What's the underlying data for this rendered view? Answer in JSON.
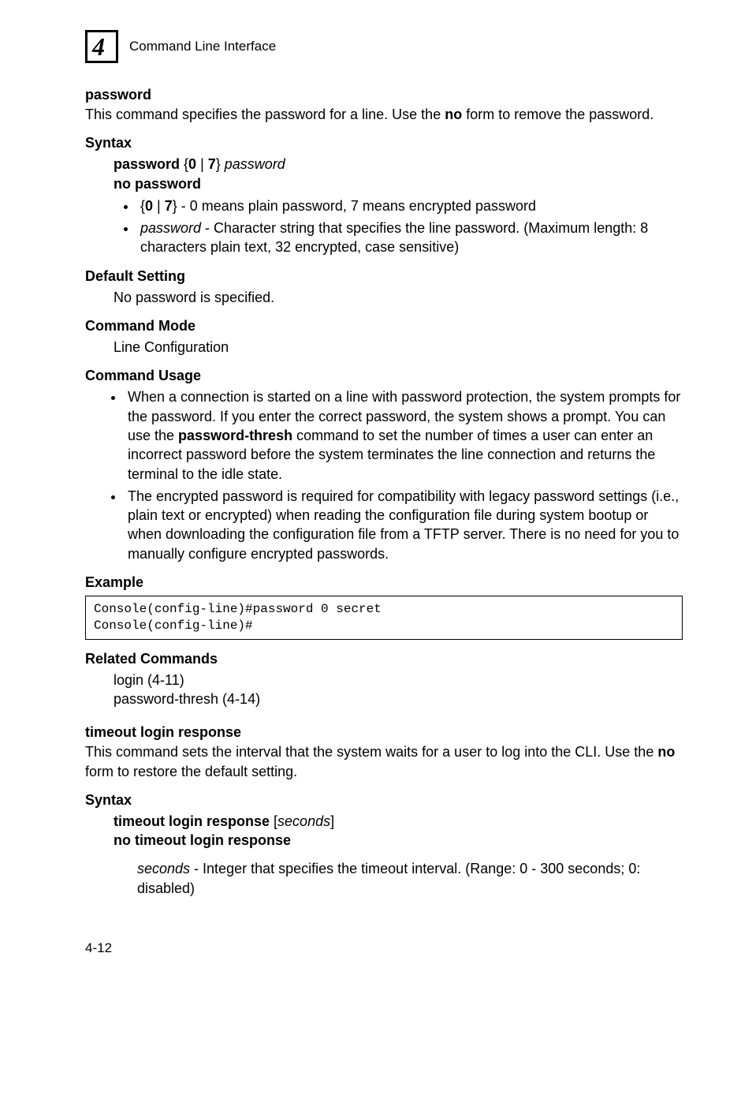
{
  "header": {
    "chapter_number": "4",
    "chapter_title": "Command Line Interface"
  },
  "password_cmd": {
    "name": "password",
    "desc_pre": "This command specifies the password for a line. Use the ",
    "desc_kw": "no",
    "desc_post": " form to remove the password.",
    "syntax_label": "Syntax",
    "syntax_kw1": "password",
    "syntax_opts_open": " {",
    "syntax_opt0": "0",
    "syntax_pipe": " | ",
    "syntax_opt7": "7",
    "syntax_opts_close": "} ",
    "syntax_arg": "password",
    "syntax_no": "no password",
    "bullets": {
      "b1_pre": "{",
      "b1_0": "0",
      "b1_pipe": " | ",
      "b1_7": "7",
      "b1_post": "} - 0 means plain password, 7 means encrypted password",
      "b2_arg": "password",
      "b2_post": " - Character string that specifies the line password. (Maximum length: 8 characters plain text, 32 encrypted, case sensitive)"
    },
    "default_label": "Default Setting",
    "default_text": "No password is specified.",
    "mode_label": "Command Mode",
    "mode_text": "Line Configuration",
    "usage_label": "Command Usage",
    "usage_b1_pre": "When a connection is started on a line with password protection, the system prompts for the password. If you enter the correct password, the system shows a prompt. You can use the ",
    "usage_b1_kw": "password-thresh",
    "usage_b1_post": " command to set the number of times a user can enter an incorrect password before the system terminates the line connection and returns the terminal to the idle state.",
    "usage_b2": "The encrypted password is required for compatibility with legacy password settings (i.e., plain text or encrypted) when reading the configuration file during system bootup or when downloading the configuration file from a TFTP server. There is no need for you to manually configure encrypted passwords.",
    "example_label": "Example",
    "example_code": "Console(config-line)#password 0 secret\nConsole(config-line)#",
    "related_label": "Related Commands",
    "related_1": "login (4-11)",
    "related_2": "password-thresh (4-14)"
  },
  "timeout_cmd": {
    "name": "timeout login response",
    "desc_pre": "This command sets the interval that the system waits for a user to log into the CLI. Use the ",
    "desc_kw": "no",
    "desc_post": " form to restore the default setting.",
    "syntax_label": "Syntax",
    "syntax_kw": "timeout login response",
    "syntax_open": " [",
    "syntax_arg": "seconds",
    "syntax_close": "]",
    "syntax_no": "no timeout login response",
    "arg_name": "seconds",
    "arg_desc": " - Integer that specifies the timeout interval. (Range: 0 - 300 seconds; 0: disabled)"
  },
  "footer": {
    "page": "4-12"
  }
}
